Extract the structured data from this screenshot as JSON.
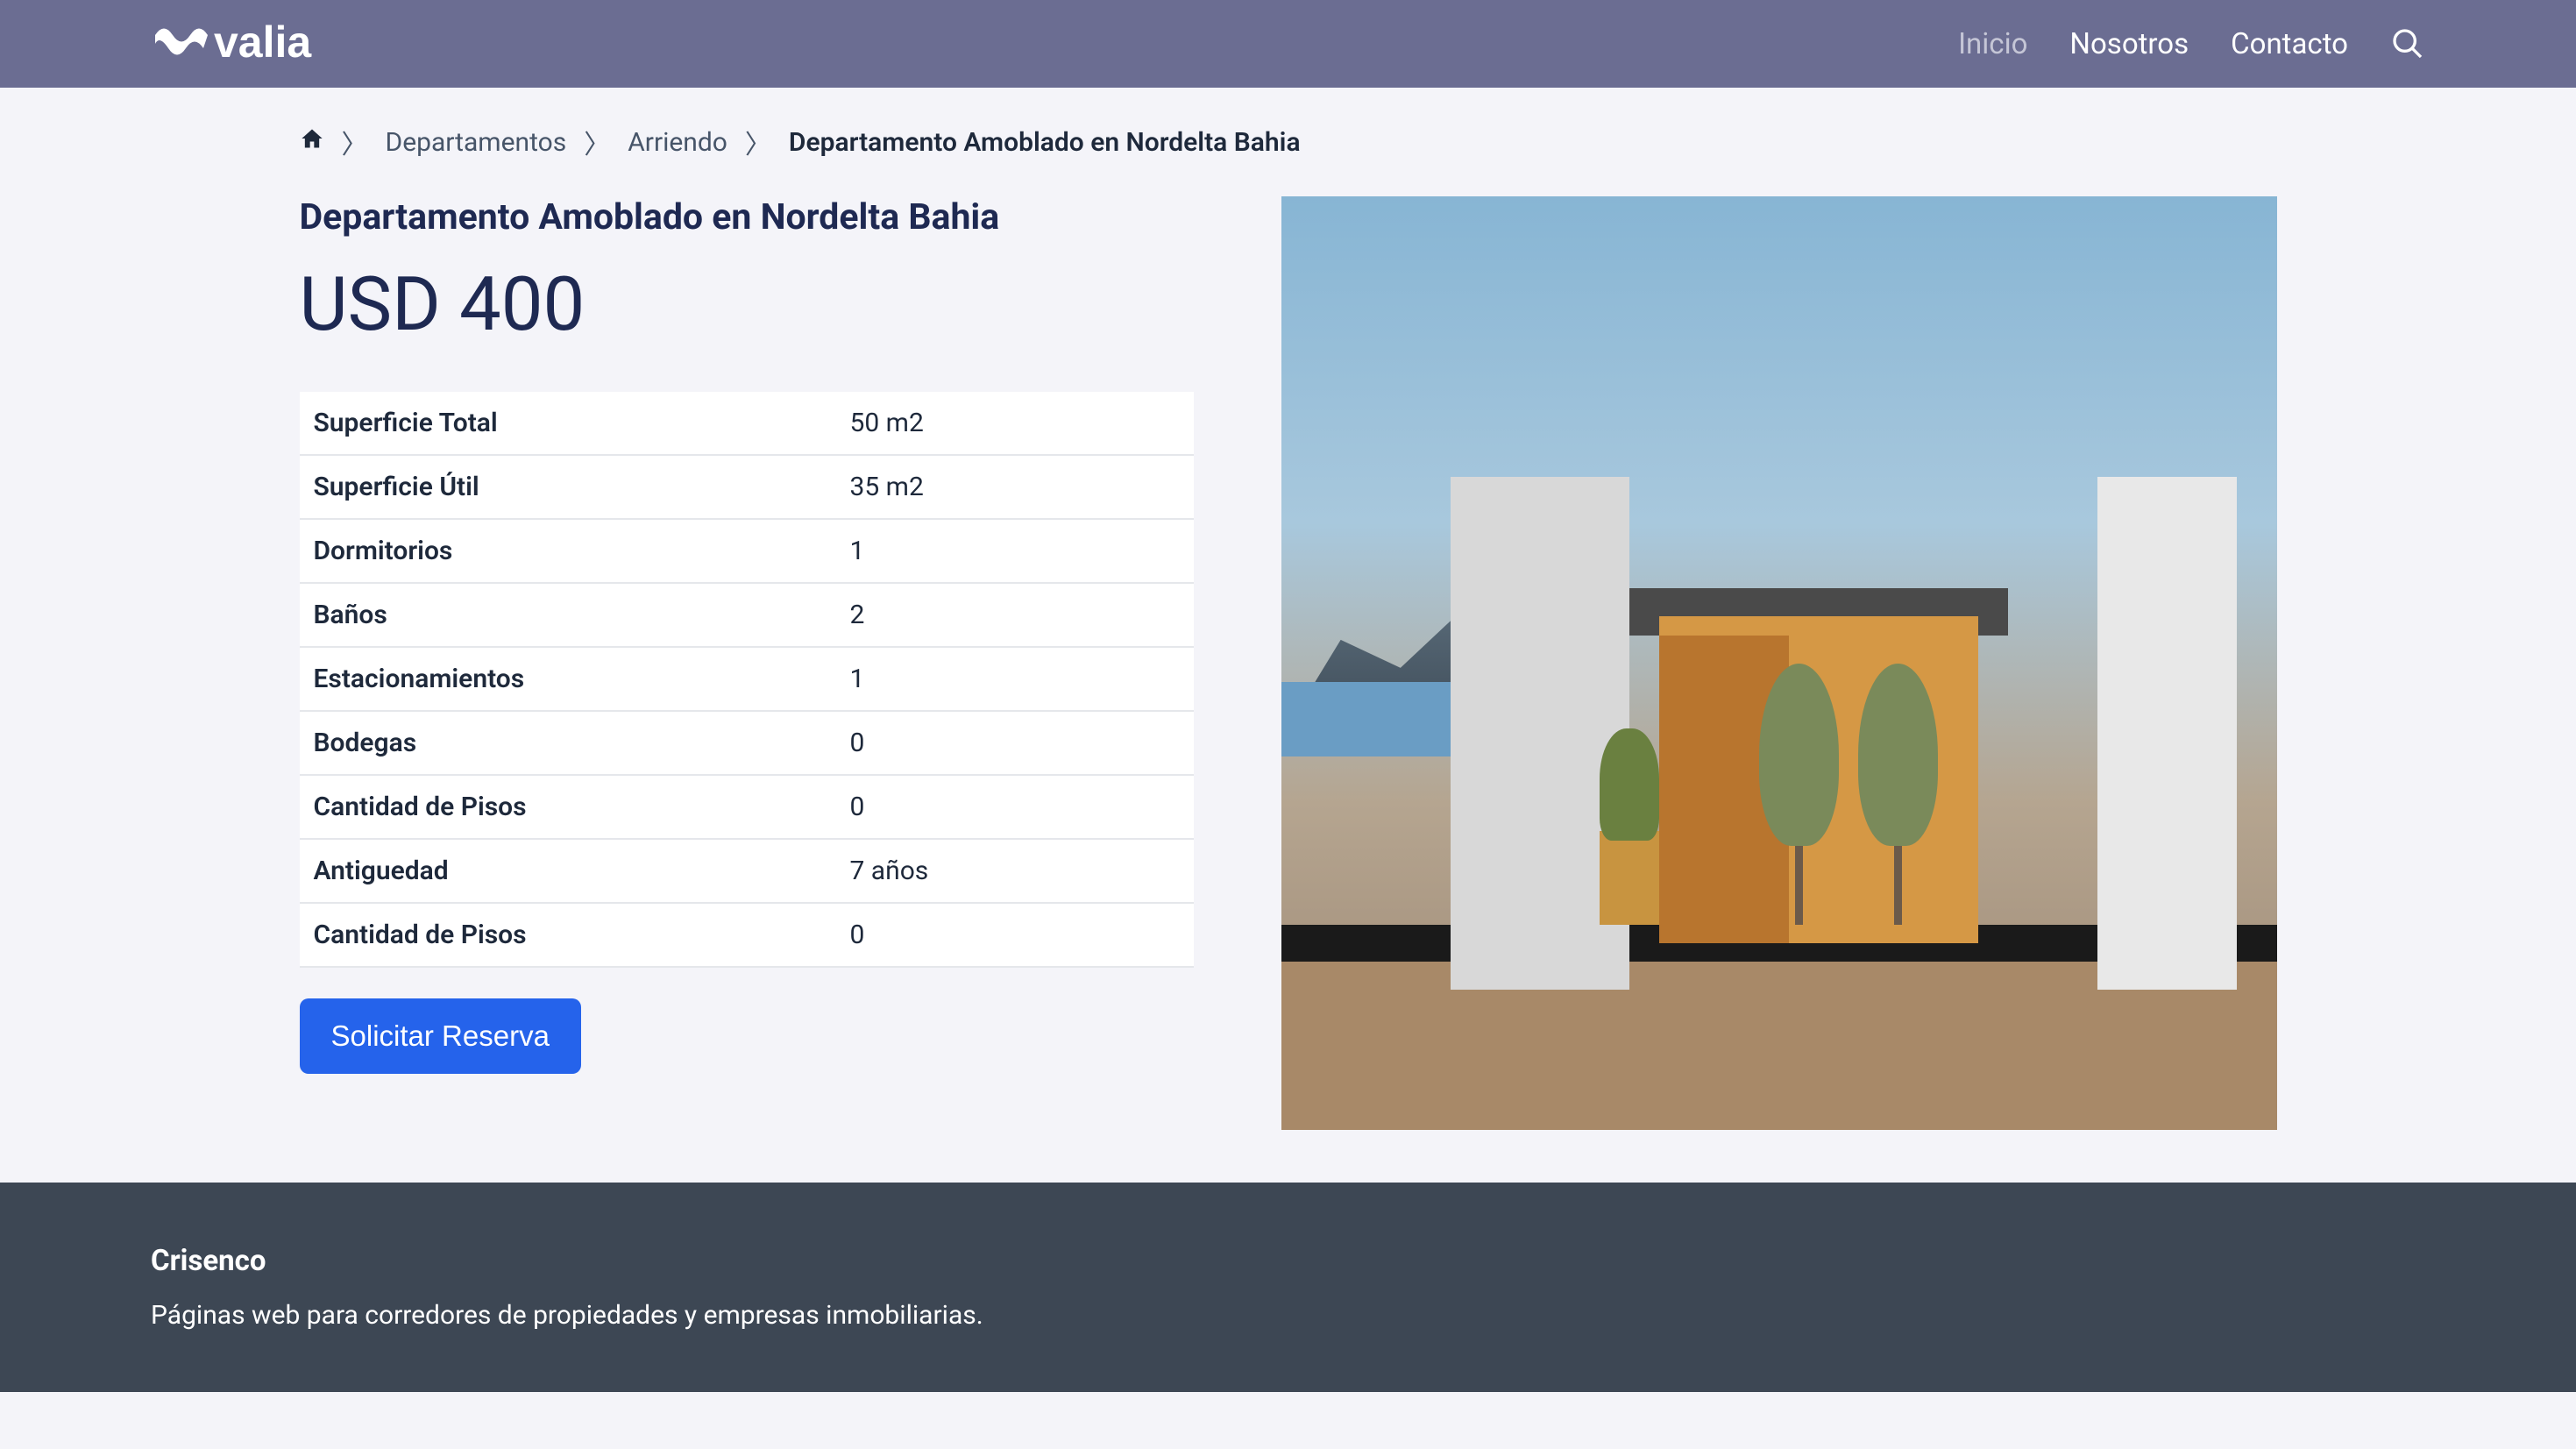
{
  "header": {
    "logo_text": "valia",
    "nav": [
      {
        "label": "Inicio",
        "active": true
      },
      {
        "label": "Nosotros",
        "active": false
      },
      {
        "label": "Contacto",
        "active": false
      }
    ]
  },
  "breadcrumb": {
    "items": [
      {
        "label": "Departamentos",
        "link": true
      },
      {
        "label": "Arriendo",
        "link": true
      },
      {
        "label": "Departamento Amoblado en Nordelta Bahia",
        "link": false
      }
    ]
  },
  "main": {
    "title": "Departamento Amoblado en Nordelta Bahia",
    "price": "USD 400",
    "properties": [
      {
        "label": "Superficie Total",
        "value": "50 m2"
      },
      {
        "label": "Superficie Útil",
        "value": "35 m2"
      },
      {
        "label": "Dormitorios",
        "value": "1"
      },
      {
        "label": "Baños",
        "value": "2"
      },
      {
        "label": "Estacionamientos",
        "value": "1"
      },
      {
        "label": "Bodegas",
        "value": "0"
      },
      {
        "label": "Cantidad de Pisos",
        "value": "0"
      },
      {
        "label": "Antiguedad",
        "value": "7 años"
      },
      {
        "label": "Cantidad de Pisos",
        "value": "0"
      }
    ],
    "reserve_button": "Solicitar Reserva"
  },
  "footer": {
    "title": "Crisenco",
    "text": "Páginas web para corredores de propiedades y empresas inmobiliarias."
  }
}
